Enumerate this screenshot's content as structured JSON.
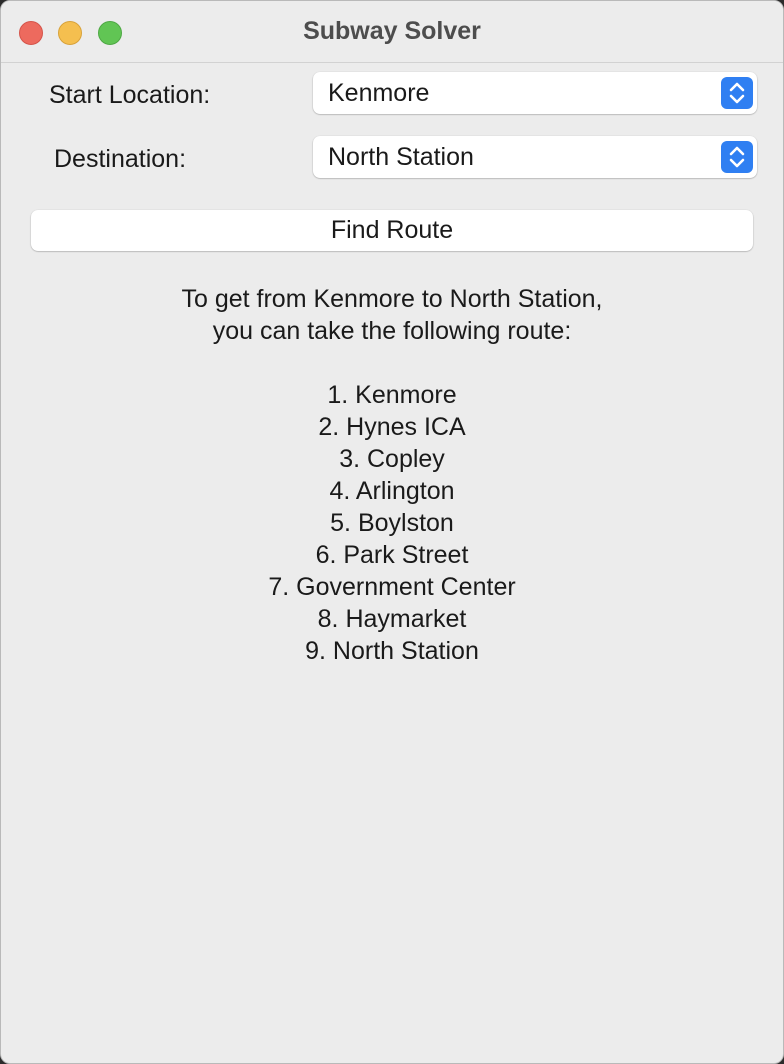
{
  "window": {
    "title": "Subway Solver"
  },
  "form": {
    "start_label": "Start Location:",
    "start_value": "Kenmore",
    "destination_label": "Destination:",
    "destination_value": "North Station",
    "find_button": "Find Route"
  },
  "result": {
    "intro_line1": "To get from Kenmore to North Station,",
    "intro_line2": "you can take the following route:",
    "route": [
      "1. Kenmore",
      "2. Hynes ICA",
      "3. Copley",
      "4. Arlington",
      "5. Boylston",
      "6. Park Street",
      "7. Government Center",
      "8. Haymarket",
      "9. North Station"
    ]
  },
  "colors": {
    "accent": "#2f7ff2",
    "close": "#ed6a5e",
    "minimize": "#f5bf4f",
    "maximize": "#61c554",
    "window_bg": "#ececec"
  }
}
